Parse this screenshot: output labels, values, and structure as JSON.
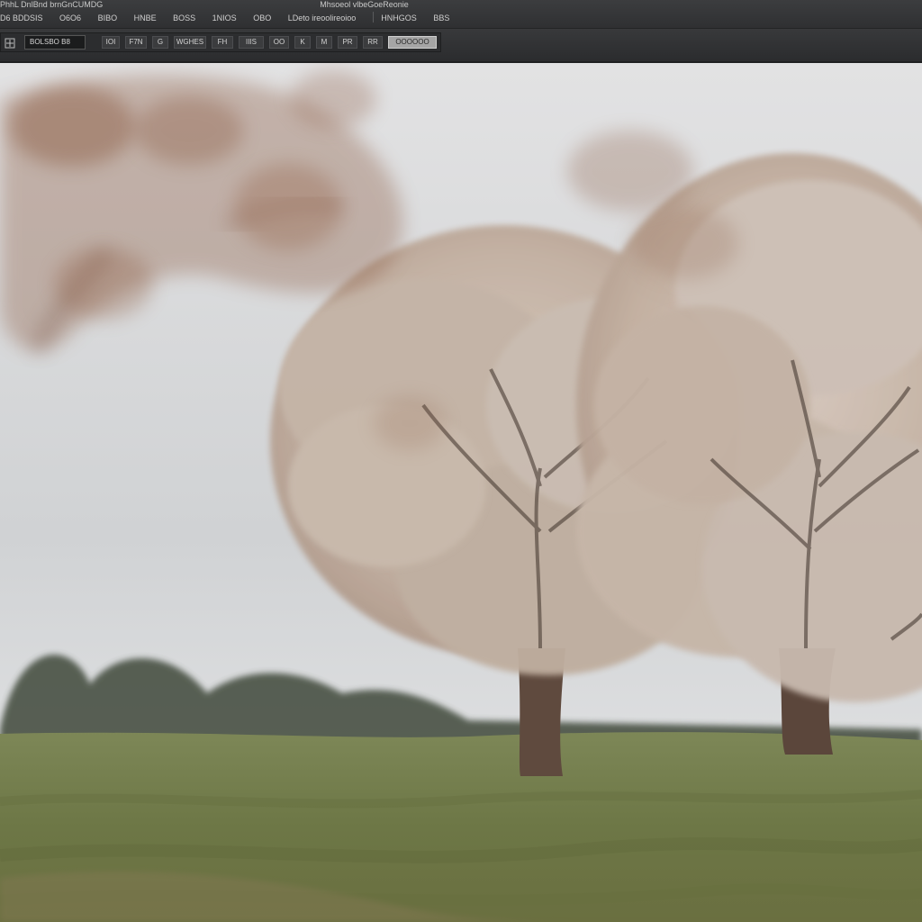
{
  "menubar": {
    "title_left": "PhhL DnlBnd brnGnCUMDG",
    "title_right": "Mhsoeol vlbeGoeReonie",
    "items": [
      "D6 BDDSIS",
      "O6O6",
      "BIBO",
      "HNBE",
      "BOSS",
      "1NIOS",
      "OBO",
      "LDeto ireoolireoioo",
      "HNHGOS",
      "BBS"
    ]
  },
  "options_bar": {
    "tool_icon": "move-tool-icon",
    "field_value": "BOLSBO B8",
    "buttons": [
      "IOI",
      "F7N",
      "G",
      "WGHES",
      "FH",
      "IIIS",
      "OO",
      "K",
      "M",
      "PR",
      "RR"
    ],
    "select_label": "OOOOOO"
  },
  "colors": {
    "ui_dark": "#2f3032",
    "sky": "#d8d9da",
    "grass": "#6f7a4a",
    "blossom": "#c9b8a8",
    "trunk": "#5f4a3e"
  }
}
